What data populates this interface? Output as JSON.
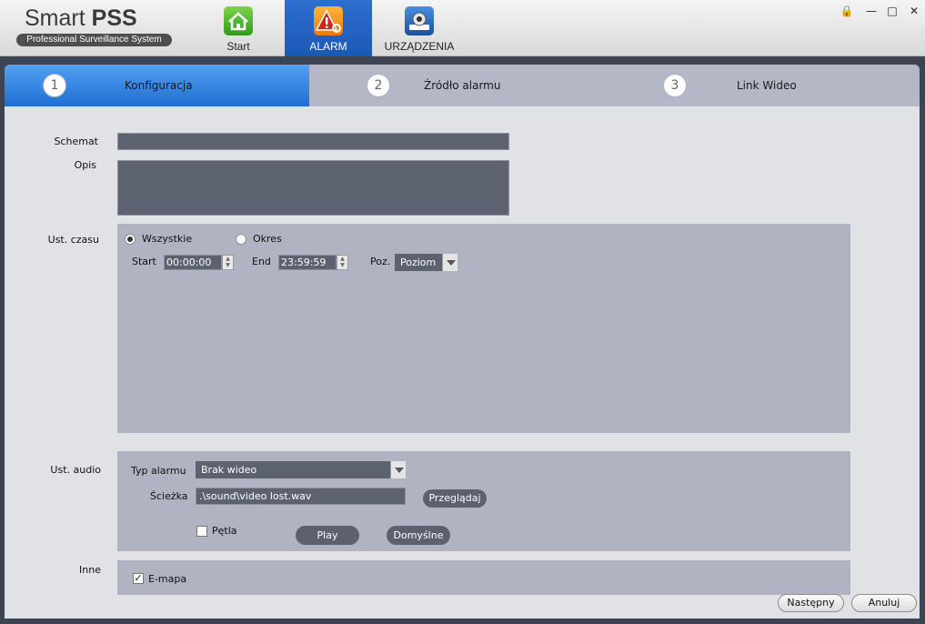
{
  "app": {
    "title_prefix": "Smart",
    "title_bold": "PSS",
    "subtitle": "Professional Surveillance System"
  },
  "nav": {
    "tabs": [
      {
        "label": "Start",
        "icon": "home-icon"
      },
      {
        "label": "ALARM",
        "icon": "alarm-icon",
        "active": true
      },
      {
        "label": "URZĄDZENIA",
        "icon": "device-icon"
      }
    ]
  },
  "window": {
    "lock": "🔒",
    "minimize": "—",
    "maximize": "□",
    "close": "✕"
  },
  "steps": [
    {
      "num": "1",
      "label": "Konfiguracja",
      "active": true
    },
    {
      "num": "2",
      "label": "Źródło alarmu"
    },
    {
      "num": "3",
      "label": "Link Wideo"
    }
  ],
  "form": {
    "schemat_label": "Schemat",
    "schemat_value": "",
    "opis_label": "Opis",
    "opis_value": "",
    "time_label": "Ust. czasu",
    "radio_all": "Wszystkie",
    "radio_period": "Okres",
    "start_label": "Start",
    "start_value": "00:00:00",
    "end_label": "End",
    "end_value": "23:59:59",
    "poz_label": "Poz.",
    "poz_value": "Poziom",
    "audio_label": "Ust. audio",
    "alarm_type_label": "Typ alarmu",
    "alarm_type_value": "Brak wideo",
    "path_label": "Ścieżka",
    "path_value": ".\\sound\\video lost.wav",
    "browse": "Przeglądaj",
    "loop_label": "Pętla",
    "play": "Play",
    "default": "Domyślne",
    "other_label": "Inne",
    "emap_label": "E-mapa",
    "emap_checked": "✓"
  },
  "footer": {
    "next": "Następny",
    "cancel": "Anuluj"
  }
}
